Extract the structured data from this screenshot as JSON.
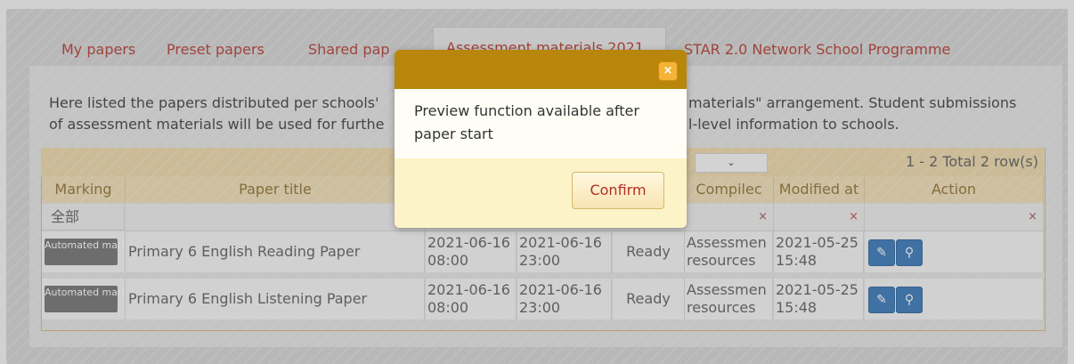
{
  "tabs": [
    {
      "label": "My papers"
    },
    {
      "label": "Preset papers"
    },
    {
      "label": "Shared pap"
    },
    {
      "label": "Assessment materials 2021"
    },
    {
      "label": "STAR 2.0 Network School Programme"
    }
  ],
  "description": {
    "line1_left": "Here listed the papers distributed per schools'",
    "line1_right": "materials\" arrangement. Student submissions",
    "line2_left": "of assessment materials will be used for furthe",
    "line2_right": "l-level information to schools."
  },
  "pager": {
    "dropdown_symbol": "⌄",
    "info": "1 - 2 Total 2 row(s)"
  },
  "columns": {
    "marking": "Marking",
    "paper_title": "Paper title",
    "compiled": "Compilec",
    "modified": "Modified at",
    "action": "Action"
  },
  "filter": {
    "marking_value": "全部",
    "clear_symbol": "×"
  },
  "rows": [
    {
      "badge": "Automated marking",
      "title": "Primary 6 English Reading Paper",
      "start": "2021-06-16 08:00",
      "end": "2021-06-16 23:00",
      "status": "Ready",
      "compiled": "Assessmen resources",
      "modified": "2021-05-25 15:48"
    },
    {
      "badge": "Automated marking",
      "title": "Primary 6 English Listening Paper",
      "start": "2021-06-16 08:00",
      "end": "2021-06-16 23:00",
      "status": "Ready",
      "compiled": "Assessmen resources",
      "modified": "2021-05-25 15:48"
    }
  ],
  "modal": {
    "close_symbol": "×",
    "message": "Preview function available after paper start",
    "confirm_label": "Confirm"
  },
  "colors": {
    "modal_header": "#b8860b",
    "tab_text": "#b03025",
    "action_button": "#2a6fb4"
  },
  "icons": {
    "edit": "pencil-icon",
    "preview": "magnifier-icon",
    "close": "close-icon"
  }
}
